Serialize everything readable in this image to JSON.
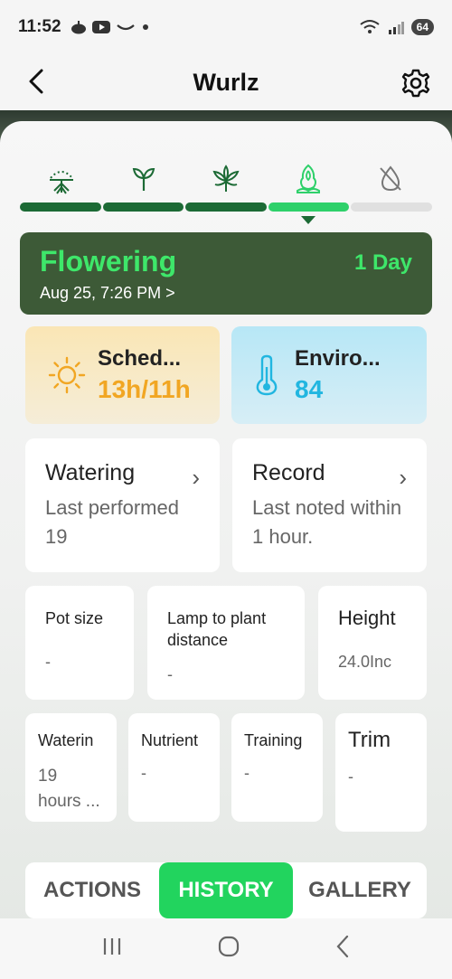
{
  "status_bar": {
    "time": "11:52",
    "battery": "64"
  },
  "header": {
    "title": "Wurlz"
  },
  "stages": {
    "icons": [
      "germination-icon",
      "seedling-icon",
      "vegetative-icon",
      "flowering-icon",
      "harvest-icon"
    ],
    "progress": [
      "done",
      "done",
      "done",
      "active",
      "todo"
    ],
    "active_color": "#2ed06a",
    "done_color": "#1c6a35"
  },
  "current_stage": {
    "name": "Flowering",
    "duration": "1 Day",
    "date": "Aug 25, 7:26 PM >"
  },
  "schedule": {
    "title": "Sched...",
    "value": "13h/11h"
  },
  "environment": {
    "title": "Enviro...",
    "value": "84"
  },
  "watering": {
    "title": "Watering",
    "subtitle": "Last performed 19"
  },
  "record": {
    "title": "Record",
    "subtitle": "Last noted within 1 hour."
  },
  "pot_size": {
    "title": "Pot size",
    "value": "-"
  },
  "lamp_distance": {
    "title": "Lamp to plant distance",
    "value": "-"
  },
  "height": {
    "title": "Height",
    "value": "24.0Inc"
  },
  "watering_small": {
    "title": "Waterin",
    "value": "19 hours ..."
  },
  "nutrient": {
    "title": "Nutrient",
    "value": "-"
  },
  "training": {
    "title": "Training",
    "value": "-"
  },
  "trim": {
    "title": "Trim",
    "value": "-"
  },
  "tabs": {
    "actions": "ACTIONS",
    "history": "HISTORY",
    "gallery": "GALLERY",
    "active": "history"
  }
}
